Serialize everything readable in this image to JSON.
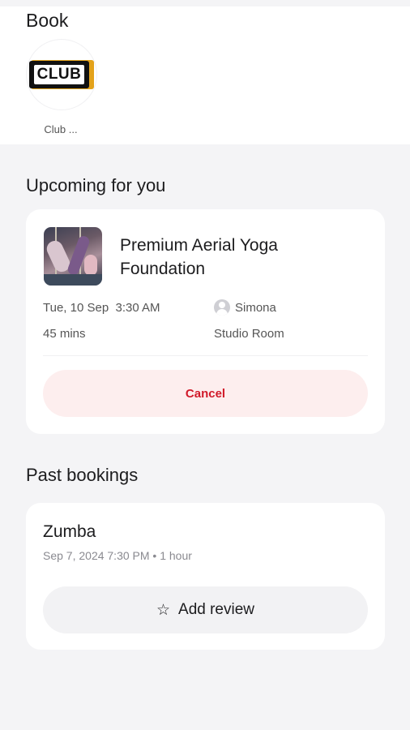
{
  "book": {
    "title": "Book",
    "clubs": [
      {
        "logo_text": "CLUB",
        "caption": "Club ..."
      }
    ]
  },
  "upcoming": {
    "heading": "Upcoming for you",
    "booking": {
      "title": "Premium Aerial Yoga Foundation",
      "date": "Tue, 10 Sep",
      "time": "3:30 AM",
      "duration": "45 mins",
      "instructor": "Simona",
      "room": "Studio Room",
      "cancel_label": "Cancel"
    }
  },
  "past": {
    "heading": "Past bookings",
    "booking": {
      "title": "Zumba",
      "meta": "Sep 7, 2024 7:30 PM • 1 hour",
      "review_label": "Add review",
      "review_icon": "star-outline-icon"
    }
  },
  "colors": {
    "accent_red": "#d11a2a",
    "cancel_bg": "#fdeeee",
    "page_bg": "#f4f4f6",
    "card_bg": "#ffffff"
  }
}
